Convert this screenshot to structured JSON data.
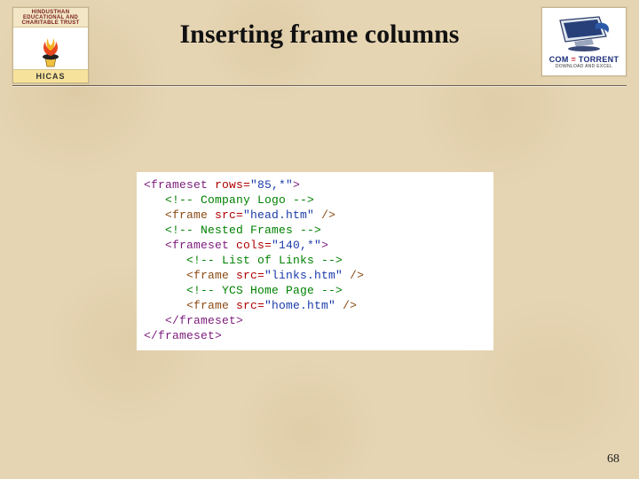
{
  "title": "Inserting frame columns",
  "page_number": "68",
  "logo_left": {
    "top_text": "HINDUSTHAN EDUCATIONAL AND CHARITABLE TRUST",
    "bottom_text": "HICAS"
  },
  "logo_right": {
    "brand_left": "COM",
    "brand_eq": " = ",
    "brand_right": "TORRENT",
    "subtext": "DOWNLOAD AND EXCEL"
  },
  "code": {
    "lines": [
      {
        "indent": 0,
        "parts": [
          {
            "c": "k",
            "t": "<frameset "
          },
          {
            "c": "a",
            "t": "rows="
          },
          {
            "c": "s",
            "t": "\"85,*\""
          },
          {
            "c": "k",
            "t": ">"
          }
        ]
      },
      {
        "indent": 1,
        "parts": [
          {
            "c": "cm",
            "t": "<!-- Company Logo -->"
          }
        ]
      },
      {
        "indent": 1,
        "parts": [
          {
            "c": "t",
            "t": "<frame "
          },
          {
            "c": "a",
            "t": "src="
          },
          {
            "c": "s",
            "t": "\"head.htm\""
          },
          {
            "c": "t",
            "t": " />"
          }
        ]
      },
      {
        "indent": 1,
        "parts": [
          {
            "c": "cm",
            "t": "<!-- Nested Frames -->"
          }
        ]
      },
      {
        "indent": 1,
        "parts": [
          {
            "c": "k",
            "t": "<frameset "
          },
          {
            "c": "a",
            "t": "cols="
          },
          {
            "c": "s",
            "t": "\"140,*\""
          },
          {
            "c": "k",
            "t": ">"
          }
        ]
      },
      {
        "indent": 2,
        "parts": [
          {
            "c": "cm",
            "t": "<!-- List of Links -->"
          }
        ]
      },
      {
        "indent": 2,
        "parts": [
          {
            "c": "t",
            "t": "<frame "
          },
          {
            "c": "a",
            "t": "src="
          },
          {
            "c": "s",
            "t": "\"links.htm\""
          },
          {
            "c": "t",
            "t": " />"
          }
        ]
      },
      {
        "indent": 2,
        "parts": [
          {
            "c": "cm",
            "t": "<!-- YCS Home Page -->"
          }
        ]
      },
      {
        "indent": 2,
        "parts": [
          {
            "c": "t",
            "t": "<frame "
          },
          {
            "c": "a",
            "t": "src="
          },
          {
            "c": "s",
            "t": "\"home.htm\""
          },
          {
            "c": "t",
            "t": " />"
          }
        ]
      },
      {
        "indent": 1,
        "parts": [
          {
            "c": "k",
            "t": "</frameset>"
          }
        ]
      },
      {
        "indent": 0,
        "parts": [
          {
            "c": "k",
            "t": "</frameset>"
          }
        ]
      }
    ]
  }
}
